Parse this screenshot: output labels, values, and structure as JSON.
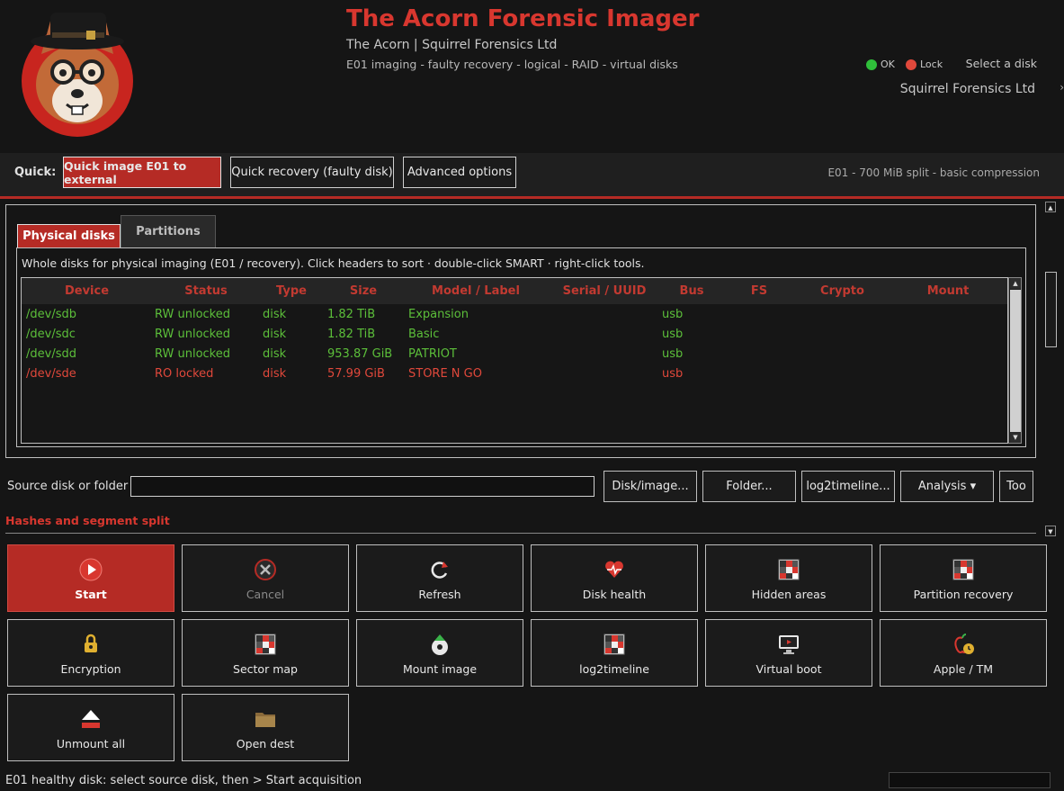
{
  "header": {
    "title": "The Acorn Forensic Imager",
    "subtitle": "The Acorn | Squirrel Forensics Ltd",
    "tagline": "E01 imaging - faulty recovery - logical - RAID - virtual disks",
    "legend_ok": "OK",
    "legend_lock": "Lock",
    "select_hint": "Select a disk",
    "company": "Squirrel Forensics Ltd",
    "edge_glyph": "›",
    "colors": {
      "ok": "#2fbf3a",
      "lock": "#e0483b",
      "accent": "#b52b25"
    }
  },
  "quickbar": {
    "label": "Quick:",
    "buttons": [
      "Quick image E01 to external",
      "Quick recovery (faulty disk)",
      "Advanced options"
    ],
    "note": "E01 - 700 MiB split - basic compression"
  },
  "tabs": [
    "Physical disks",
    "Partitions"
  ],
  "disks": {
    "description": "Whole disks for physical imaging (E01 / recovery). Click headers to sort · double-click SMART · right-click tools.",
    "columns": [
      "Device",
      "Status",
      "Type",
      "Size",
      "Model / Label",
      "Serial / UUID",
      "Bus",
      "FS",
      "Crypto",
      "Mount"
    ],
    "rows": [
      {
        "device": "/dev/sdb",
        "status": "RW unlocked",
        "type": "disk",
        "size": "1.82 TiB",
        "model": "Expansion",
        "serial": "",
        "bus": "usb",
        "fs": "",
        "crypto": "",
        "mount": "",
        "state": "ok"
      },
      {
        "device": "/dev/sdc",
        "status": "RW unlocked",
        "type": "disk",
        "size": "1.82 TiB",
        "model": "Basic",
        "serial": "",
        "bus": "usb",
        "fs": "",
        "crypto": "",
        "mount": "",
        "state": "ok"
      },
      {
        "device": "/dev/sdd",
        "status": "RW unlocked",
        "type": "disk",
        "size": "953.87 GiB",
        "model": "PATRIOT",
        "serial": "",
        "bus": "usb",
        "fs": "",
        "crypto": "",
        "mount": "",
        "state": "ok"
      },
      {
        "device": "/dev/sde",
        "status": "RO locked",
        "type": "disk",
        "size": "57.99 GiB",
        "model": "STORE N GO",
        "serial": "",
        "bus": "usb",
        "fs": "",
        "crypto": "",
        "mount": "",
        "state": "bad"
      }
    ]
  },
  "source": {
    "label": "Source disk or folder",
    "value": "",
    "buttons": [
      "Disk/image...",
      "Folder...",
      "log2timeline...",
      "Analysis ▾",
      "Too"
    ]
  },
  "hashes_label": "Hashes and segment split",
  "actions": [
    {
      "label": "Start",
      "icon": "play-icon",
      "style": "primary"
    },
    {
      "label": "Cancel",
      "icon": "cancel-icon",
      "style": "disabled"
    },
    {
      "label": "Refresh",
      "icon": "refresh-icon",
      "style": "normal"
    },
    {
      "label": "Disk health",
      "icon": "heart-pulse-icon",
      "style": "normal"
    },
    {
      "label": "Hidden areas",
      "icon": "grid-icon",
      "style": "normal"
    },
    {
      "label": "Partition recovery",
      "icon": "grid-icon",
      "style": "normal"
    },
    {
      "label": "Encryption",
      "icon": "lock-icon",
      "style": "normal"
    },
    {
      "label": "Sector map",
      "icon": "grid-icon",
      "style": "normal"
    },
    {
      "label": "Mount image",
      "icon": "mount-icon",
      "style": "normal"
    },
    {
      "label": "log2timeline",
      "icon": "grid-icon",
      "style": "normal"
    },
    {
      "label": "Virtual boot",
      "icon": "monitor-icon",
      "style": "normal"
    },
    {
      "label": "Apple / TM",
      "icon": "apple-clock-icon",
      "style": "normal"
    },
    {
      "label": "Unmount all",
      "icon": "eject-icon",
      "style": "normal"
    },
    {
      "label": "Open dest",
      "icon": "folder-icon",
      "style": "normal"
    }
  ],
  "status": {
    "text": "E01 healthy disk: select source disk, then > Start acquisition"
  }
}
